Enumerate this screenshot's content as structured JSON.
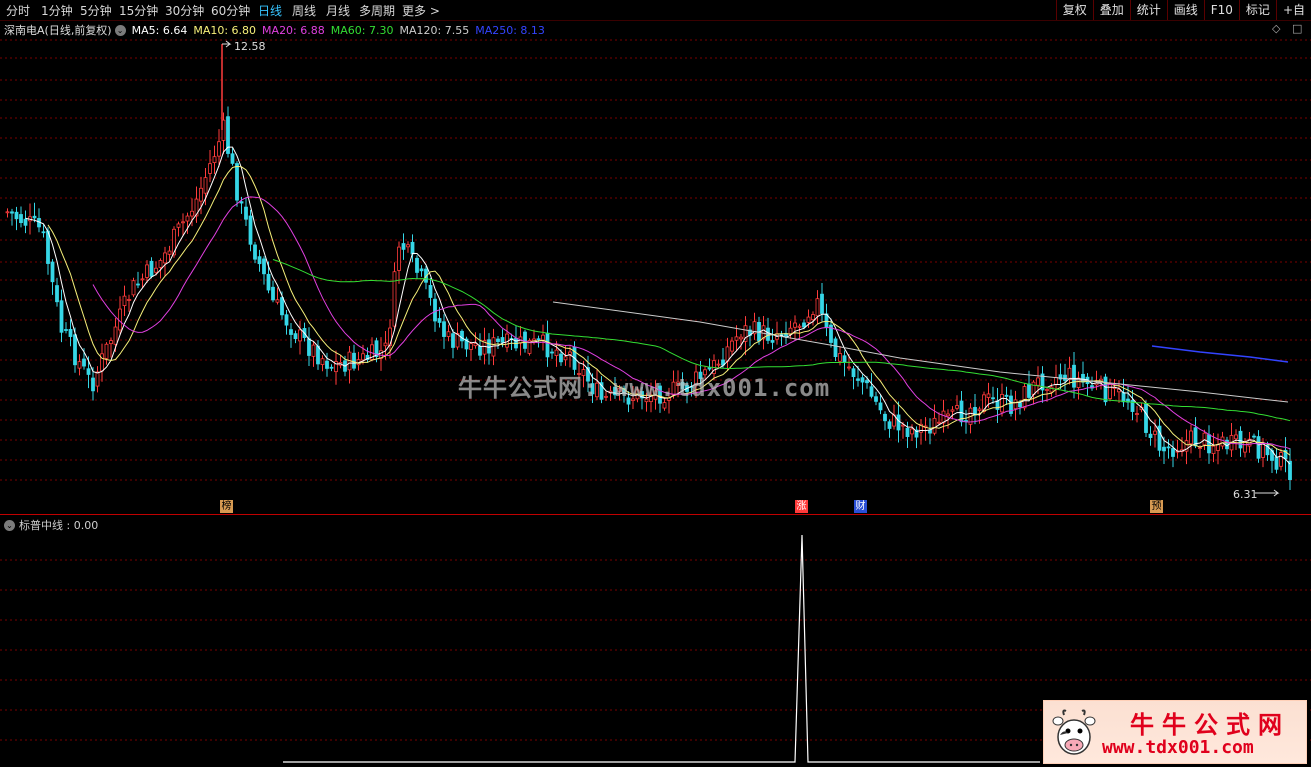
{
  "toolbar": {
    "periods": [
      "分时",
      "1分钟",
      "5分钟",
      "15分钟",
      "30分钟",
      "60分钟",
      "日线",
      "周线",
      "月线",
      "多周期",
      "更多 >"
    ],
    "active": "日线",
    "right_buttons": [
      "复权",
      "叠加",
      "统计",
      "画线",
      "F10",
      "标记",
      "+自"
    ]
  },
  "legend": {
    "title": "深南电A(日线,前复权)",
    "ma": [
      {
        "label": "MA5: 6.64",
        "color": "#ffffff"
      },
      {
        "label": "MA10: 6.80",
        "color": "#f6f07a"
      },
      {
        "label": "MA20: 6.88",
        "color": "#e040e0"
      },
      {
        "label": "MA60: 7.30",
        "color": "#33dd33"
      },
      {
        "label": "MA120: 7.55",
        "color": "#cccccc"
      },
      {
        "label": "MA250: 8.13",
        "color": "#3344ff"
      }
    ]
  },
  "price_max": "12.58",
  "price_min": "6.31",
  "markers": [
    {
      "text": "榜",
      "style": "orange"
    },
    {
      "text": "涨",
      "style": "red"
    },
    {
      "text": "财",
      "style": "blue"
    },
    {
      "text": "预",
      "style": "orange"
    }
  ],
  "indicator": {
    "label": "标普中线 : 0.00"
  },
  "watermark": "牛牛公式网: www.tdx001.com",
  "logo": {
    "title": "牛牛公式网",
    "url": "www.tdx001.com"
  },
  "colors": {
    "up": "#ff3c3c",
    "down": "#36d6e6",
    "grid": "#8a0000"
  }
}
